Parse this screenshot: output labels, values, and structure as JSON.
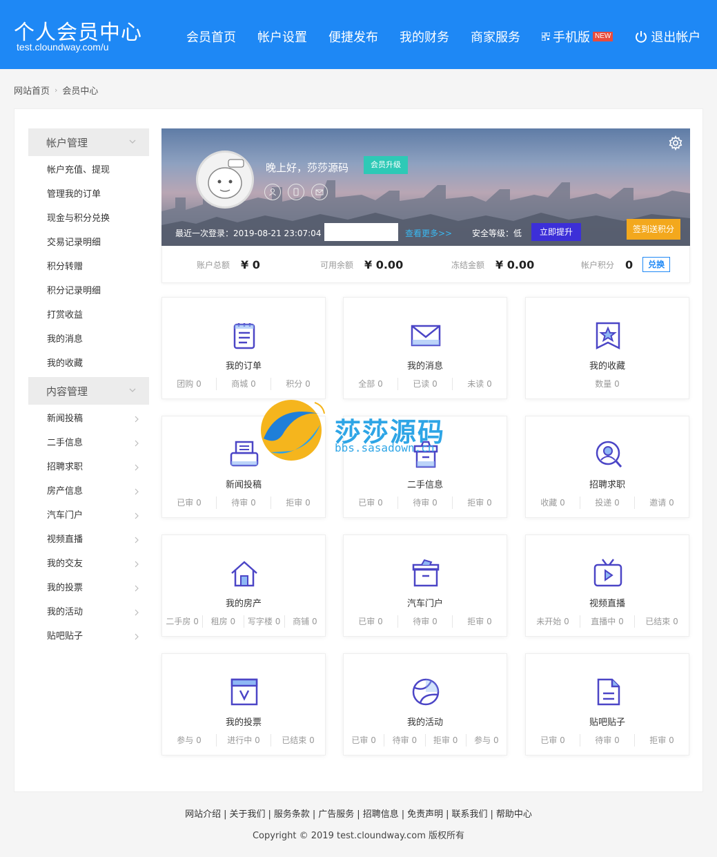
{
  "header": {
    "title": "个人会员中心",
    "url": "test.cloundway.com/u",
    "nav": [
      "会员首页",
      "帐户设置",
      "便捷发布",
      "我的财务",
      "商家服务"
    ],
    "mobile_label": "手机版",
    "new_badge": "NEW",
    "logout_label": "退出帐户",
    "bg_color": "#1e88f5"
  },
  "breadcrumb": [
    "网站首页",
    "会员中心"
  ],
  "sidebar": {
    "group1": "帐户管理",
    "group1_items": [
      "帐户充值、提现",
      "管理我的订单",
      "现金与积分兑换",
      "交易记录明细",
      "积分转赠",
      "积分记录明细",
      "打赏收益",
      "我的消息",
      "我的收藏"
    ],
    "group2": "内容管理",
    "group2_items": [
      "新闻投稿",
      "二手信息",
      "招聘求职",
      "房产信息",
      "汽车门户",
      "视频直播",
      "我的交友",
      "我的投票",
      "我的活动",
      "贴吧贴子"
    ]
  },
  "profile": {
    "greeting": "晚上好，莎莎源码",
    "upgrade_label": "会员升级",
    "last_login": "最近一次登录：2019-08-21 23:07:04",
    "more_link": "查看更多>>",
    "security": "安全等级：低",
    "raise_label": "立即提升",
    "sign_label": "签到送积分"
  },
  "balance": {
    "total_label": "账户总额",
    "total_value": "¥ 0",
    "available_label": "可用余额",
    "available_value": "¥ 0.00",
    "frozen_label": "冻结金额",
    "frozen_value": "¥ 0.00",
    "points_label": "帐户积分",
    "points_value": "0",
    "redeem_label": "兑换"
  },
  "cards": [
    {
      "title": "我的订单",
      "icon": "order-icon",
      "stats": [
        "团购 0",
        "商城 0",
        "积分 0"
      ]
    },
    {
      "title": "我的消息",
      "icon": "mail-icon",
      "stats": [
        "全部 0",
        "已读 0",
        "未读 0"
      ]
    },
    {
      "title": "我的收藏",
      "icon": "star-icon",
      "stats": [
        "数量 0"
      ]
    },
    {
      "title": "新闻投稿",
      "icon": "printer-icon",
      "stats": [
        "已审 0",
        "待审 0",
        "拒审 0"
      ]
    },
    {
      "title": "二手信息",
      "icon": "trash-icon",
      "stats": [
        "已审 0",
        "待审 0",
        "拒审 0"
      ]
    },
    {
      "title": "招聘求职",
      "icon": "user-search-icon",
      "stats": [
        "收藏 0",
        "投递 0",
        "邀请 0"
      ]
    },
    {
      "title": "我的房产",
      "icon": "house-icon",
      "stats": [
        "二手房 0",
        "租房 0",
        "写字楼 0",
        "商铺 0"
      ]
    },
    {
      "title": "汽车门户",
      "icon": "box-icon",
      "stats": [
        "已审 0",
        "待审 0",
        "拒审 0"
      ]
    },
    {
      "title": "视频直播",
      "icon": "tv-icon",
      "stats": [
        "未开始 0",
        "直播中 0",
        "已结束 0"
      ]
    },
    {
      "title": "我的投票",
      "icon": "vote-icon",
      "stats": [
        "参与 0",
        "进行中 0",
        "已结束 0"
      ]
    },
    {
      "title": "我的活动",
      "icon": "ball-icon",
      "stats": [
        "已审 0",
        "待审 0",
        "拒审 0",
        "参与 0"
      ]
    },
    {
      "title": "贴吧贴子",
      "icon": "document-icon",
      "stats": [
        "已审 0",
        "待审 0",
        "拒审 0"
      ]
    }
  ],
  "watermark": {
    "text": "莎莎源码",
    "url": "bbs.sasadown.cn"
  },
  "footer": {
    "links": [
      "网站介绍",
      "关于我们",
      "服务条款",
      "广告服务",
      "招聘信息",
      "免责声明",
      "联系我们",
      "帮助中心"
    ],
    "copyright": "Copyright © 2019 test.cloundway.com 版权所有"
  }
}
